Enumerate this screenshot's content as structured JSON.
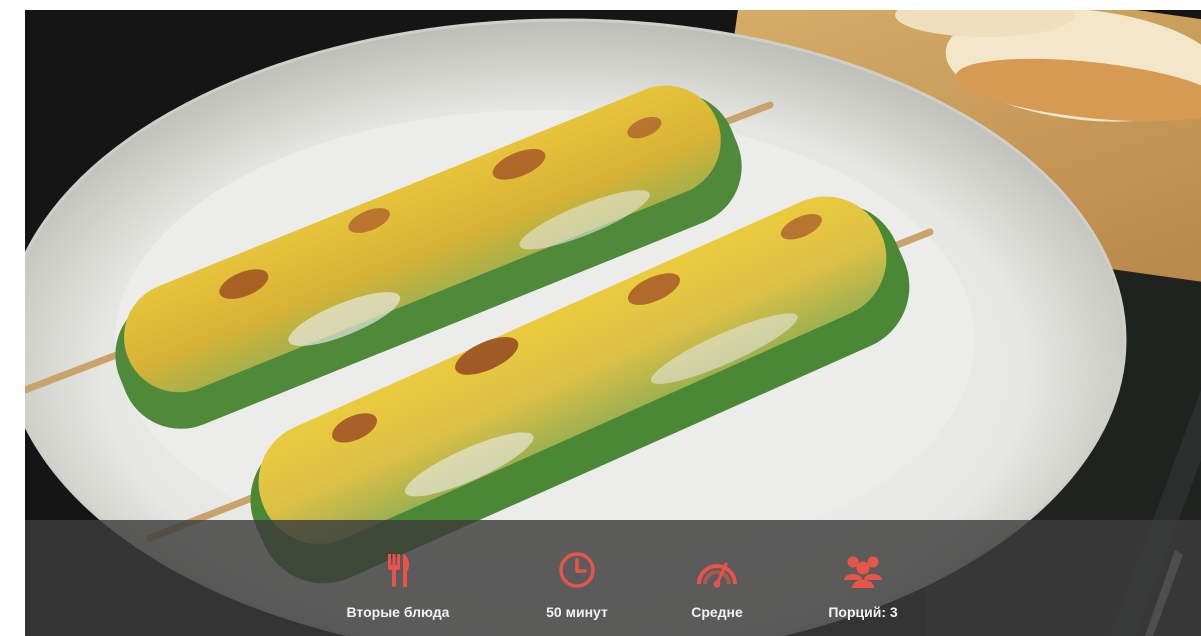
{
  "meta": {
    "items": [
      {
        "icon": "cutlery-icon",
        "label": "Вторые блюда"
      },
      {
        "icon": "clock-icon",
        "label": "50 минут"
      },
      {
        "icon": "speedometer-icon",
        "label": "Средне"
      },
      {
        "icon": "people-icon",
        "label": "Порций: 3"
      }
    ]
  },
  "colors": {
    "accent": "#e8534a",
    "bar_background": "#3c3c3c",
    "label_text": "#f2f2f2"
  }
}
